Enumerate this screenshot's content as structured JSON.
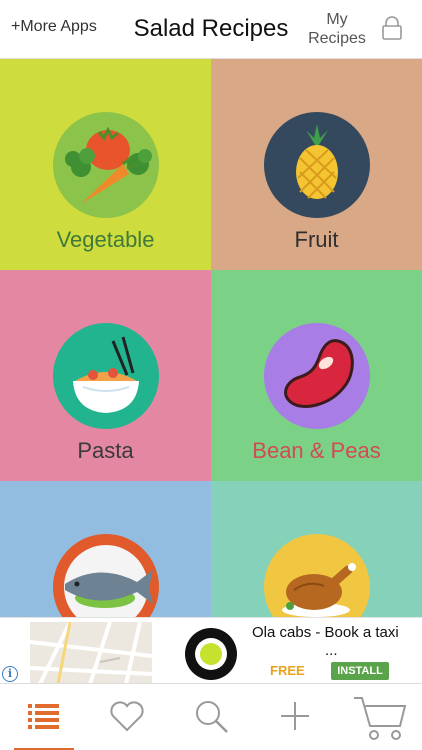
{
  "header": {
    "more_apps": "+More Apps",
    "title": "Salad Recipes",
    "my_recipes_line1": "My",
    "my_recipes_line2": "Recipes"
  },
  "categories": [
    {
      "label": "Vegetable",
      "label_color": "#3f7a3a",
      "icon": "vegetable-icon"
    },
    {
      "label": "Fruit",
      "label_color": "#2f2f2f",
      "icon": "pineapple-icon"
    },
    {
      "label": "Pasta",
      "label_color": "#3a3a3a",
      "icon": "noodle-bowl-icon"
    },
    {
      "label": "Bean & Peas",
      "label_color": "#d14b55",
      "icon": "bean-icon"
    },
    {
      "label": "",
      "icon": "fish-icon"
    },
    {
      "label": "",
      "icon": "roast-chicken-icon"
    }
  ],
  "ad": {
    "title": "Ola cabs - Book a taxi",
    "ellipsis": "...",
    "price": "FREE",
    "cta": "INSTALL"
  },
  "tabbar": {
    "items": [
      "list-icon",
      "heart-icon",
      "search-icon",
      "plus-icon",
      "cart-icon"
    ],
    "active": "list-icon",
    "accent_color": "#e26a2c"
  }
}
